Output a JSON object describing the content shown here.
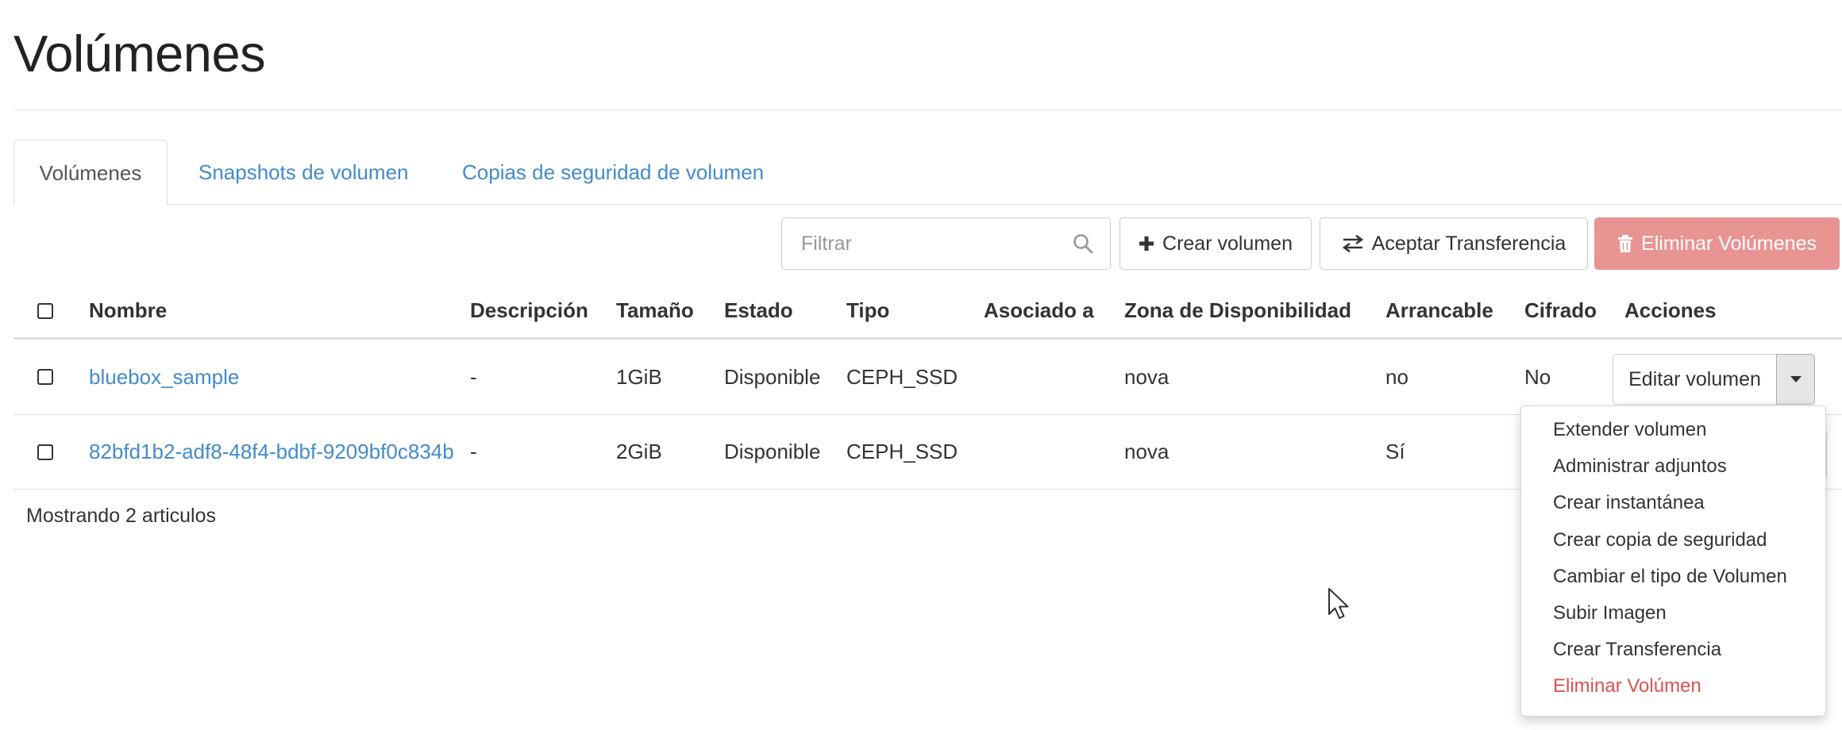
{
  "page": {
    "title": "Volúmenes"
  },
  "tabs": [
    {
      "label": "Volúmenes",
      "active": true
    },
    {
      "label": "Snapshots de volumen",
      "active": false
    },
    {
      "label": "Copias de seguridad de volumen",
      "active": false
    }
  ],
  "toolbar": {
    "filter_placeholder": "Filtrar",
    "filter_value": "",
    "create_label": "Crear volumen",
    "accept_transfer_label": "Aceptar Transferencia",
    "delete_label": "Eliminar Volúmenes"
  },
  "table": {
    "headers": {
      "name": "Nombre",
      "description": "Descripción",
      "size": "Tamaño",
      "status": "Estado",
      "type": "Tipo",
      "attached": "Asociado a",
      "zone": "Zona de Disponibilidad",
      "bootable": "Arrancable",
      "encrypted": "Cifrado",
      "actions": "Acciones"
    },
    "rows": [
      {
        "name": "bluebox_sample",
        "description": "-",
        "size": "1GiB",
        "status": "Disponible",
        "type": "CEPH_SSD",
        "attached": "",
        "zone": "nova",
        "bootable": "no",
        "encrypted": "No",
        "action_label": "Editar volumen"
      },
      {
        "name": "82bfd1b2-adf8-48f4-bdbf-9209bf0c834b",
        "description": "-",
        "size": "2GiB",
        "status": "Disponible",
        "type": "CEPH_SSD",
        "attached": "",
        "zone": "nova",
        "bootable": "Sí",
        "encrypted": "",
        "action_label": ""
      }
    ],
    "footer": "Mostrando 2 articulos"
  },
  "dropdown": {
    "items": [
      "Extender volumen",
      "Administrar adjuntos",
      "Crear instantánea",
      "Crear copia de seguridad",
      "Cambiar el tipo de Volumen",
      "Subir Imagen",
      "Crear Transferencia",
      "Eliminar Volúmen"
    ]
  },
  "colors": {
    "link": "#428bca",
    "danger_button": "#e89493",
    "danger_text": "#d9534f",
    "border": "#dddddd"
  },
  "icons": {
    "search": "search-icon",
    "plus": "plus-icon",
    "transfer": "transfer-arrows-icon",
    "trash": "trash-icon",
    "caret": "caret-down-icon"
  }
}
